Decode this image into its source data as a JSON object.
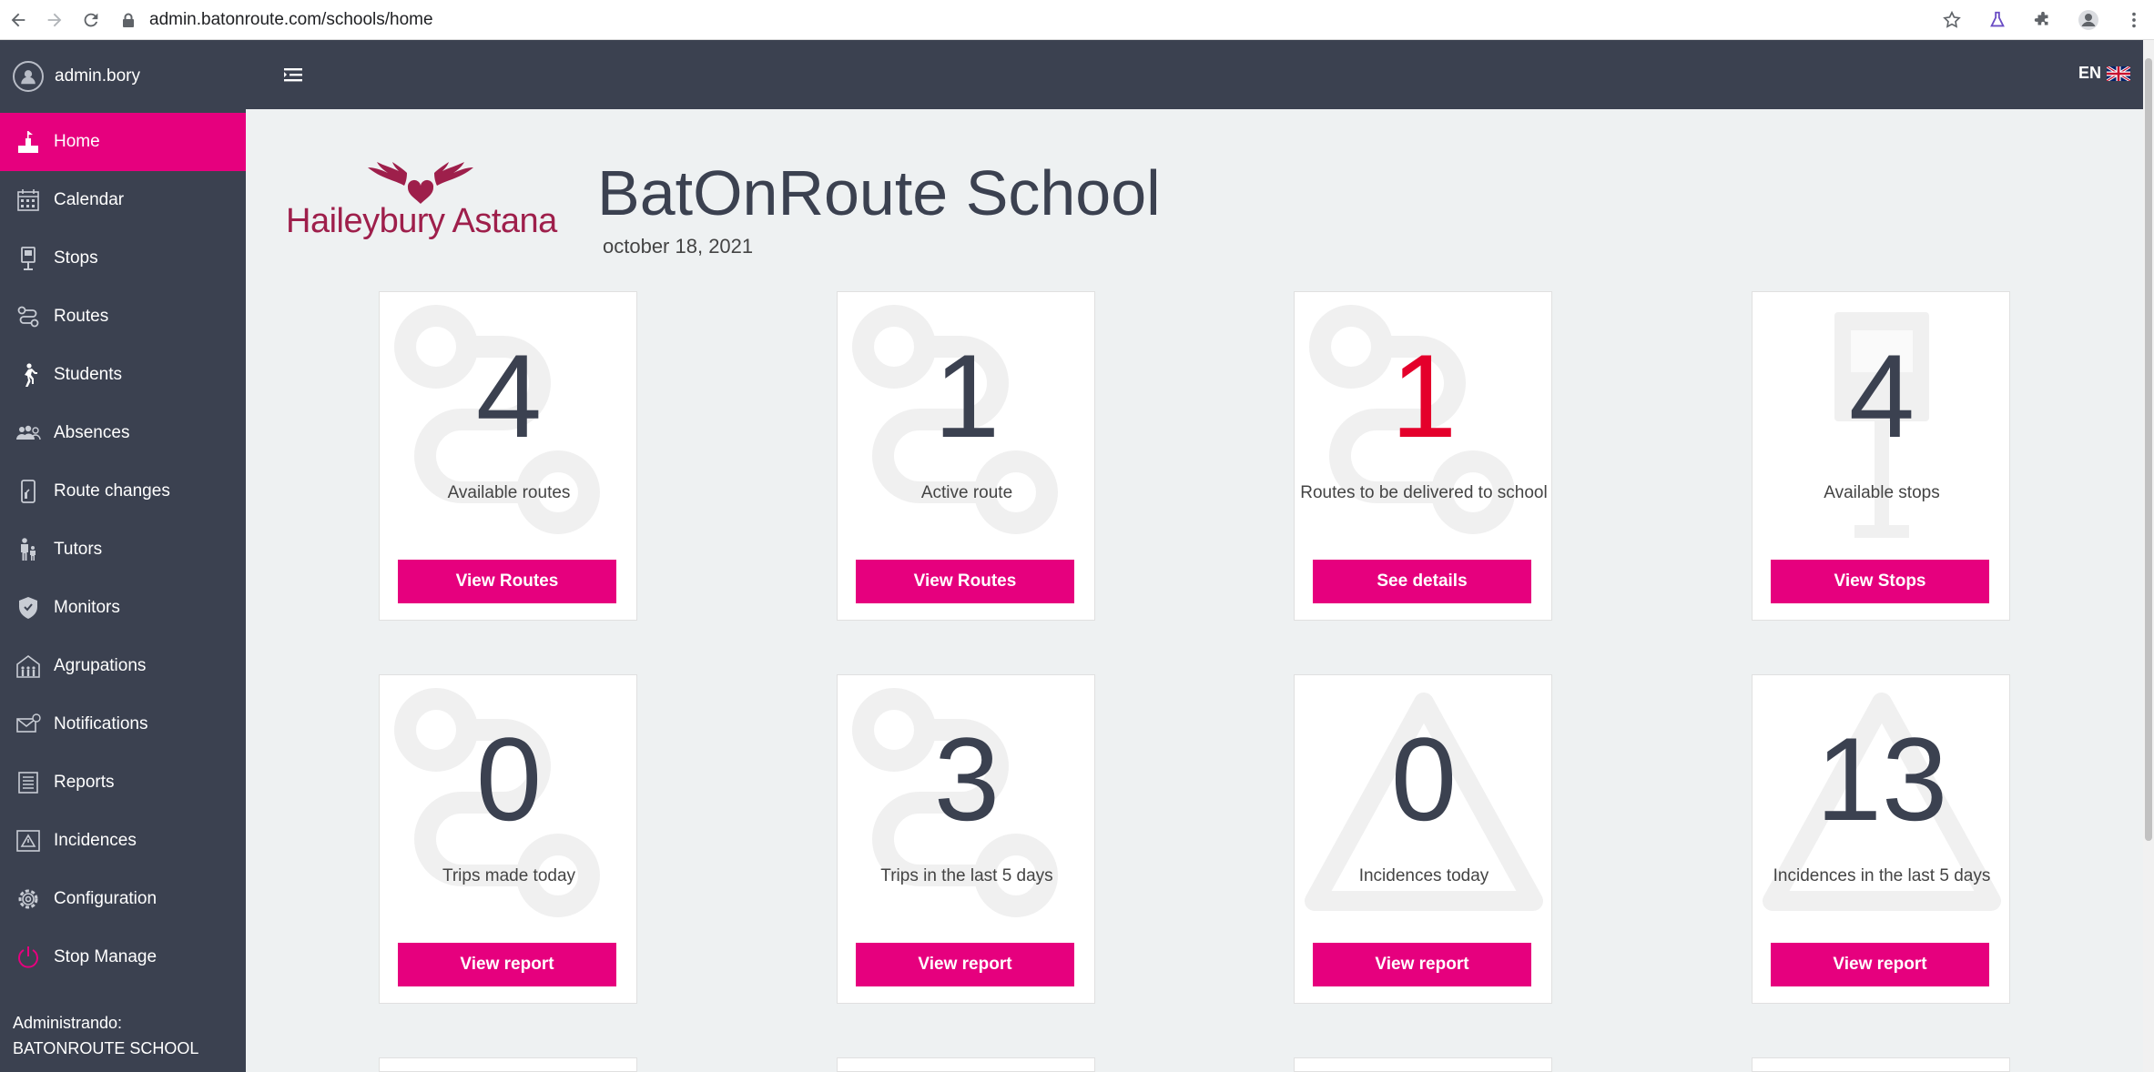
{
  "browser": {
    "url": "admin.batonroute.com/schools/home"
  },
  "sidebar": {
    "user": "admin.bory",
    "items": [
      {
        "label": "Home",
        "icon": "home-icon"
      },
      {
        "label": "Calendar",
        "icon": "calendar-icon"
      },
      {
        "label": "Stops",
        "icon": "bus-stop-icon"
      },
      {
        "label": "Routes",
        "icon": "route-icon"
      },
      {
        "label": "Students",
        "icon": "walking-student-icon"
      },
      {
        "label": "Absences",
        "icon": "absences-icon"
      },
      {
        "label": "Route changes",
        "icon": "route-changes-icon"
      },
      {
        "label": "Tutors",
        "icon": "tutors-icon"
      },
      {
        "label": "Monitors",
        "icon": "shield-icon"
      },
      {
        "label": "Agrupations",
        "icon": "agrupations-icon"
      },
      {
        "label": "Notifications",
        "icon": "envelope-icon"
      },
      {
        "label": "Reports",
        "icon": "report-icon"
      },
      {
        "label": "Incidences",
        "icon": "warning-icon"
      },
      {
        "label": "Configuration",
        "icon": "gear-icon"
      },
      {
        "label": "Stop Manage",
        "icon": "power-icon"
      }
    ],
    "admin_label": "Administrando:",
    "admin_school": "BATONROUTE SCHOOL"
  },
  "header": {
    "lang": "EN"
  },
  "main": {
    "logo_text": "Haileybury Astana",
    "title": "BatOnRoute School",
    "date": "october 18, 2021",
    "cards": [
      {
        "value": "4",
        "label": "Available routes",
        "button": "View Routes",
        "bg": "route"
      },
      {
        "value": "1",
        "label": "Active route",
        "button": "View Routes",
        "bg": "route"
      },
      {
        "value": "1",
        "label": "Routes to be delivered to school",
        "button": "See details",
        "bg": "route",
        "highlight": true
      },
      {
        "value": "4",
        "label": "Available stops",
        "button": "View Stops",
        "bg": "stop"
      },
      {
        "value": "0",
        "label": "Trips made today",
        "button": "View report",
        "bg": "route"
      },
      {
        "value": "3",
        "label": "Trips in the last 5 days",
        "button": "View report",
        "bg": "route"
      },
      {
        "value": "0",
        "label": "Incidences today",
        "button": "View report",
        "bg": "warning"
      },
      {
        "value": "13",
        "label": "Incidences in the last 5 days",
        "button": "View report",
        "bg": "warning"
      }
    ]
  },
  "colors": {
    "accent": "#e6007e",
    "sidebar": "#3b4150",
    "highlight": "#e4002b",
    "brand": "#9e1f4b"
  }
}
